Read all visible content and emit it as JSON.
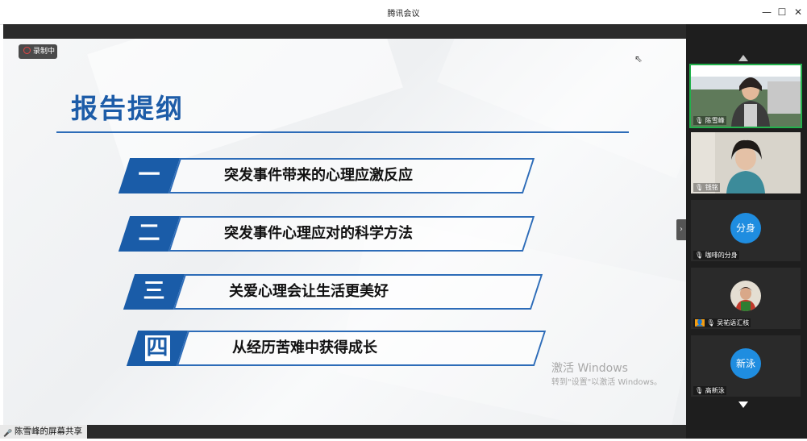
{
  "window": {
    "title": "腾讯会议",
    "min": "—",
    "max": "☐",
    "close": "✕"
  },
  "recording": {
    "label": "录制中",
    "icon": "record-icon"
  },
  "slide": {
    "heading": "报告提纲",
    "items": [
      {
        "num": "一",
        "text": "突发事件带来的心理应激反应"
      },
      {
        "num": "二",
        "text": "突发事件心理应对的科学方法"
      },
      {
        "num": "三",
        "text": "关爱心理会让生活更美好"
      },
      {
        "num": "四",
        "text": "从经历苦难中获得成长"
      }
    ],
    "accent": "#1a5ca8"
  },
  "watermark": {
    "line1": "激活 Windows",
    "line2": "转到\"设置\"以激活 Windows。"
  },
  "share": {
    "label": "陈雪峰的屏幕共享"
  },
  "toggle": {
    "label": "›"
  },
  "participants": [
    {
      "name": "陈雪峰",
      "type": "video",
      "active": true
    },
    {
      "name": "钱铭",
      "type": "video",
      "active": false
    },
    {
      "name": "咖啡的分身",
      "type": "avatar",
      "avatar_text": "分身"
    },
    {
      "name": "吴祐语汇核",
      "type": "photo"
    },
    {
      "name": "高新泳",
      "type": "avatar",
      "avatar_text": "新泳"
    }
  ]
}
